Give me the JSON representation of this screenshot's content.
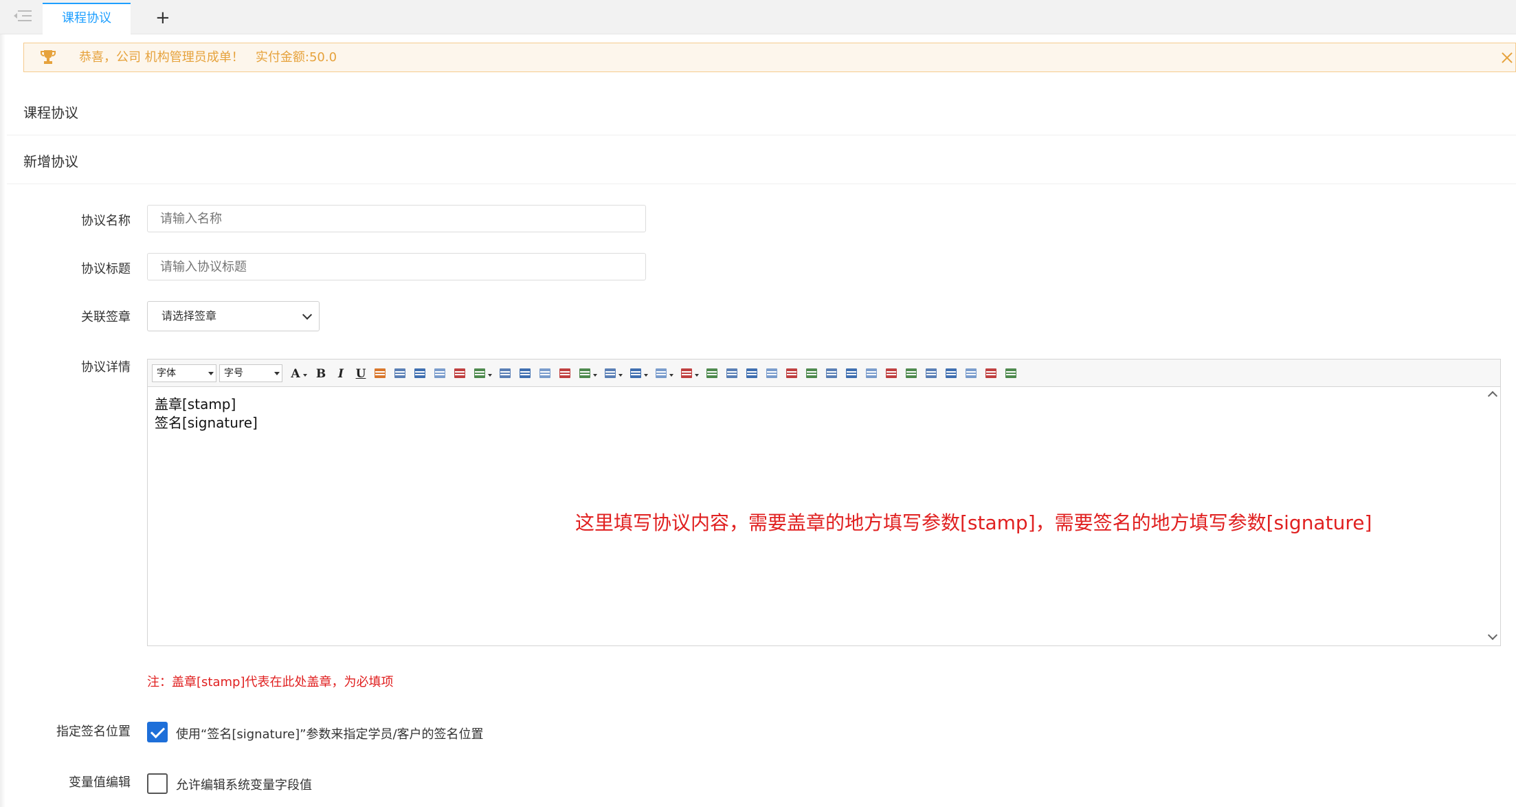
{
  "tabs": {
    "active_label": "课程协议",
    "add_label": "+"
  },
  "notice": {
    "text": "恭喜，公司 机构管理员成单！   实付金额:50.0"
  },
  "sections": {
    "list_title": "课程协议",
    "form_title": "新增协议"
  },
  "form": {
    "name_label": "协议名称",
    "name_placeholder": "请输入名称",
    "title_label": "协议标题",
    "title_placeholder": "请输入协议标题",
    "seal_label": "关联签章",
    "seal_value": "请选择签章",
    "detail_label": "协议详情",
    "note": "注：盖章[stamp]代表在此处盖章，为必填项",
    "signature_pos_label": "指定签名位置",
    "signature_pos_checked": true,
    "signature_pos_text": "使用“签名[signature]”参数来指定学员/客户的签名位置",
    "variable_label": "变量值编辑",
    "variable_checked": false,
    "variable_text": "允许编辑系统变量字段值"
  },
  "editor": {
    "font_family": "字体",
    "font_size": "字号",
    "line1": "盖章[stamp]",
    "line2": "签名[signature]",
    "toolbar_icons": [
      "font-color-icon",
      "bold-icon",
      "italic-icon",
      "underline-icon",
      "image-icon",
      "align-left-image-icon",
      "align-center-image-icon",
      "align-right-image-icon",
      "align-inline-image-icon",
      "ordered-list-icon",
      "align-left-icon",
      "align-center-icon",
      "align-right-icon",
      "justify-icon",
      "numbered-list-icon",
      "bulleted-list-icon",
      "indent-icon",
      "paragraph-icon",
      "line-height-icon",
      "table-icon",
      "table-insert-icon",
      "table-delete-icon",
      "insert-row-icon",
      "insert-col-icon",
      "merge-cells-icon",
      "split-cells-icon",
      "delete-col-icon",
      "delete-row-icon",
      "table-props-icon",
      "cell-props-icon",
      "merge-right-icon",
      "merge-down-icon",
      "delete-table-icon",
      "page-icon",
      "preview-icon"
    ]
  },
  "annotation": {
    "hint": "这里填写协议内容，需要盖章的地方填写参数[stamp]，需要签名的地方填写参数[signature]"
  },
  "colors": {
    "accent": "#1e9fff",
    "warning": "#e6a23c",
    "danger": "#e02020",
    "checkbox": "#1e6fd9"
  }
}
